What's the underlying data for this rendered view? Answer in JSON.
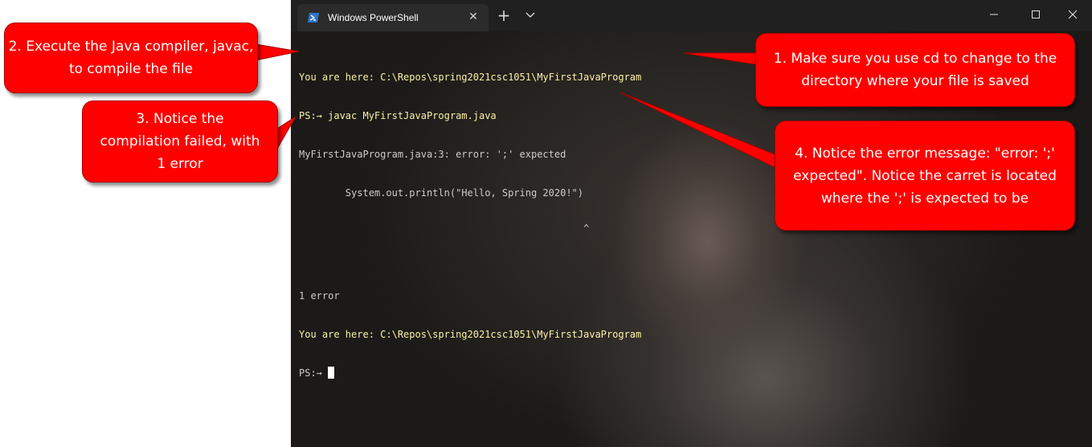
{
  "window": {
    "tab_title": "Windows PowerShell",
    "tab_icon": "powershell-icon",
    "new_tab_symbol": "+",
    "close_tab_symbol": "✕"
  },
  "console": {
    "lines": [
      "You are here: C:\\Repos\\spring2021csc1051\\MyFirstJavaProgram",
      "PS:→ javac MyFirstJavaProgram.java",
      "MyFirstJavaProgram.java:3: error: ';' expected",
      "        System.out.println(\"Hello, Spring 2020!\")",
      "                                                 ^",
      "1 error",
      "You are here: C:\\Repos\\spring2021csc1051\\MyFirstJavaProgram",
      "PS:→ "
    ]
  },
  "callouts": {
    "step1": "1. Make sure you use cd to change to the directory where your file is saved",
    "step2": "2. Execute the Java compiler, javac, to compile the file",
    "step3": "3. Notice the compilation failed, with 1 error",
    "step4": "4. Notice the error message: \"error: ';' expected\". Notice the carret is located where the ';' is expected to be"
  },
  "colors": {
    "callout_fill": "#ff0000",
    "prompt_text": "#f9f1a5",
    "console_text": "#cccccc",
    "titlebar": "#202020"
  }
}
